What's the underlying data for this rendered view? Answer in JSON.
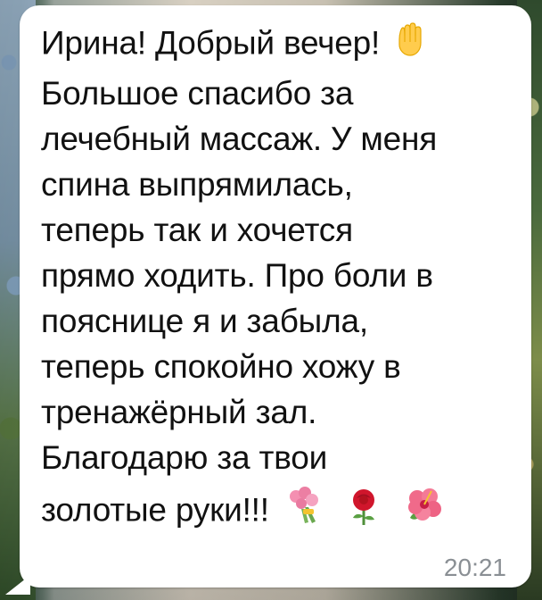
{
  "message": {
    "lines": [
      "Ирина! Добрый вечер!",
      "Большое спасибо за",
      "лечебный массаж. У меня",
      "спина выпрямилась,",
      "теперь так и хочется",
      "прямо ходить. Про боли в",
      "пояснице я и забыла,",
      "теперь спокойно хожу в",
      "тренажёрный зал.",
      "Благодарю за твои",
      "золотые руки!!!"
    ],
    "emojis": {
      "greeting": "raised-hand-icon",
      "end": [
        "tulip-bouquet-icon",
        "rose-icon",
        "hibiscus-icon"
      ]
    },
    "time": "20:21"
  },
  "colors": {
    "bubble": "#ffffff",
    "text": "#111111",
    "time": "#8a8f94"
  }
}
